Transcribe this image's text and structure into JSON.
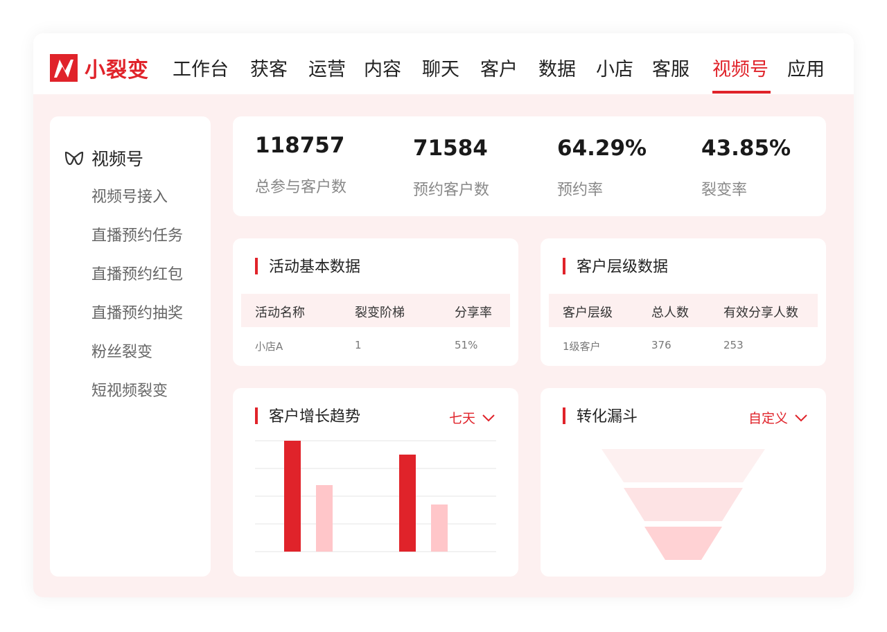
{
  "app": {
    "name": "小裂变"
  },
  "nav": {
    "items": [
      "工作台",
      "获客",
      "运营",
      "内容",
      "聊天",
      "客户",
      "数据",
      "小店",
      "客服",
      "视频号",
      "应用"
    ],
    "active_index": 9
  },
  "sidebar": {
    "header": "视频号",
    "items": [
      "视频号接入",
      "直播预约任务",
      "直播预约红包",
      "直播预约抽奖",
      "粉丝裂变",
      "短视频裂变"
    ]
  },
  "stats": [
    {
      "value": "118757",
      "label": "总参与客户数"
    },
    {
      "value": "71584",
      "label": "预约客户数"
    },
    {
      "value": "64.29%",
      "label": "预约率"
    },
    {
      "value": "43.85%",
      "label": "裂变率"
    }
  ],
  "activity_table": {
    "title": "活动基本数据",
    "columns": [
      "活动名称",
      "裂变阶梯",
      "分享率"
    ],
    "rows": [
      [
        "小店A",
        "1",
        "51%"
      ]
    ]
  },
  "customer_level_table": {
    "title": "客户层级数据",
    "columns": [
      "客户层级",
      "总人数",
      "有效分享人数"
    ],
    "rows": [
      [
        "1级客户",
        "376",
        "253"
      ]
    ]
  },
  "growth_trend": {
    "title": "客户增长趋势",
    "range": "七天"
  },
  "funnel": {
    "title": "转化漏斗",
    "range": "自定义",
    "levels": 3
  },
  "colors": {
    "accent": "#e0232a",
    "accent_light": "#ffc6c9",
    "background": "#fdf0f0"
  },
  "chart_data": {
    "type": "bar",
    "categories": [
      "",
      ""
    ],
    "series": [
      {
        "values": [
          4,
          3.5
        ]
      },
      {
        "values": [
          2.4,
          1.7
        ]
      }
    ],
    "ylim": [
      0,
      4
    ],
    "grid": true
  }
}
